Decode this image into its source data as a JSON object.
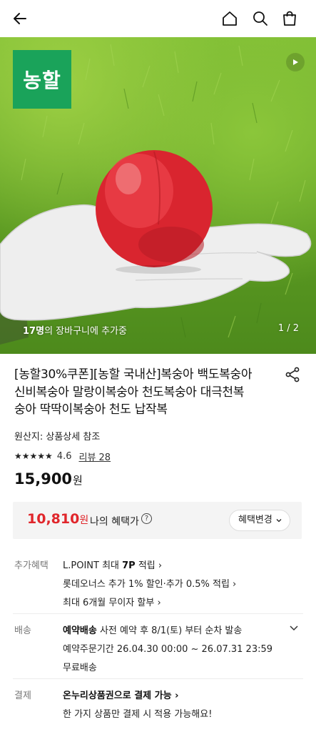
{
  "header": {
    "back_icon": "arrow-left-icon",
    "home_icon": "home-icon",
    "search_icon": "search-icon",
    "cart_icon": "shopping-bag-icon"
  },
  "hero": {
    "logo_text": "농할",
    "cart_count": "17명",
    "cart_text": "의 장바구니에 추가중",
    "pager": "1 / 2",
    "play_icon": "play-icon"
  },
  "product": {
    "title_line1": "[농할30%쿠폰][농할 국내산]복숭아 백도복숭아",
    "title_line2": "신비복숭아 말랑이복숭아 천도복숭아 대극천복",
    "title_line3": "숭아 딱딱이복숭아 천도 납작복",
    "origin": "원산지: 상품상세 참조",
    "stars": "★★★★★",
    "rating": "4.6",
    "review_label": "리뷰 28",
    "price": "15,900",
    "price_unit": "원"
  },
  "benefit": {
    "price": "10,810",
    "price_unit": "원",
    "label": "나의 혜택가",
    "help": "?",
    "change_label": "혜택변경"
  },
  "extra_benefits": {
    "label": "추가혜택",
    "line1_prefix": "L.POINT 최대 ",
    "line1_bold": "7P",
    "line1_suffix": " 적립 ›",
    "line2": "롯데오너스 추가 1% 할인·추가 0.5% 적립 ›",
    "line3": "최대 6개월 무이자 할부 ›"
  },
  "delivery": {
    "label": "배송",
    "line1_bold": "예약배송",
    "line1_rest": " 사전 예약 후 8/1(토) 부터 순차 발송",
    "line2": "예약주문기간 26.04.30 00:00 ~ 26.07.31 23:59",
    "line3": "무료배송"
  },
  "payment": {
    "label": "결제",
    "line1": "온누리상품권으로 결제 가능 ›",
    "line2": "한 가지 상품만 결제 시 적용 가능해요!"
  },
  "colors": {
    "accent_red": "#e0262b",
    "brand_green": "#1aa35a"
  }
}
